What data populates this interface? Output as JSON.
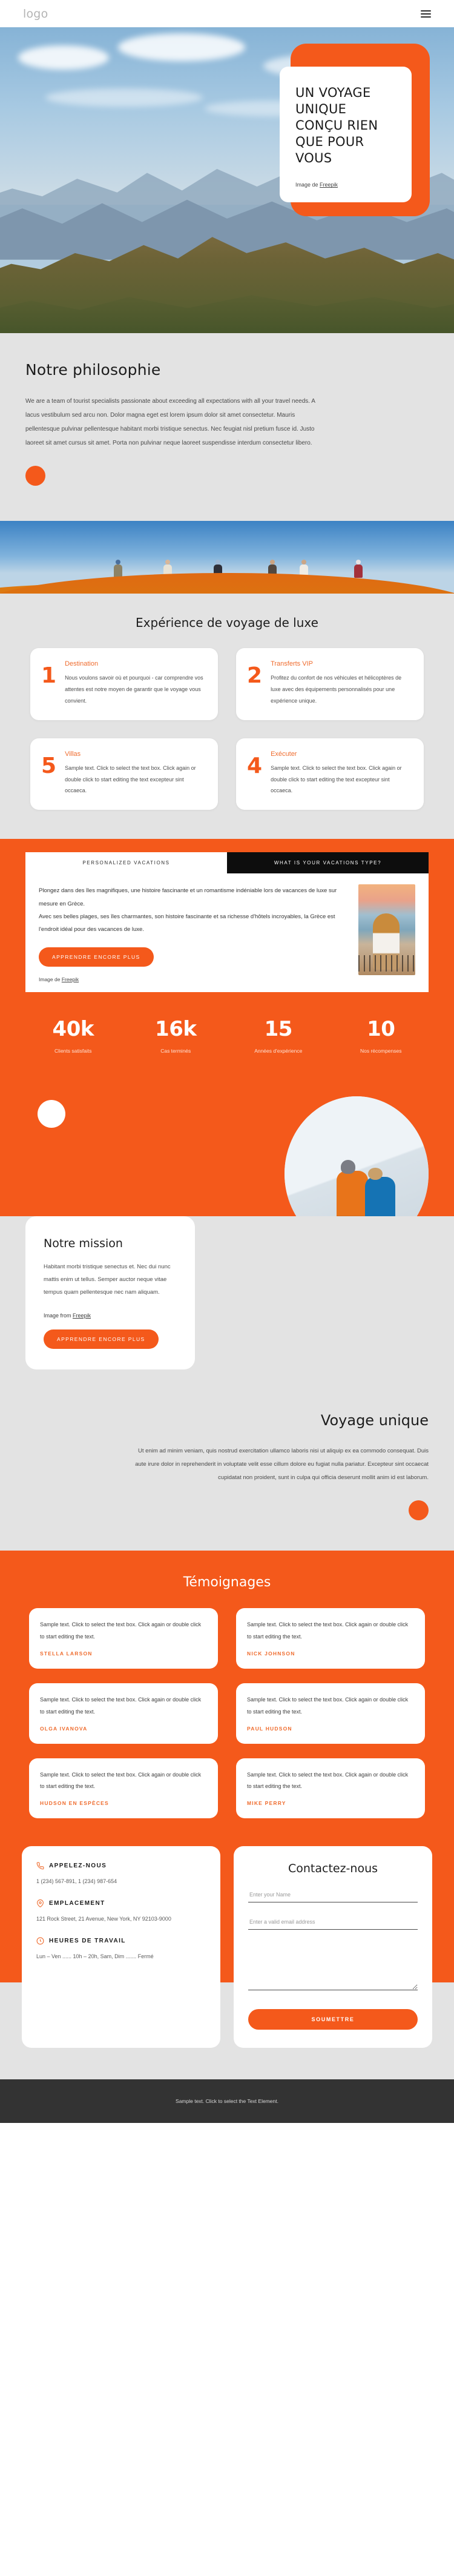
{
  "header": {
    "logo": "logo",
    "menu_icon": "hamburger-menu-icon"
  },
  "hero": {
    "title": "UN VOYAGE UNIQUE CONÇU RIEN QUE POUR VOUS",
    "credit_prefix": "Image de ",
    "credit_link": "Freepik",
    "accent_color": "#f4591b"
  },
  "philosophy": {
    "heading": "Notre philosophie",
    "body": "We are a team of tourist specialists passionate about exceeding all expectations with all your travel needs. A lacus vestibulum sed arcu non. Dolor magna eget est lorem ipsum dolor sit amet consectetur. Mauris pellentesque pulvinar pellentesque habitant morbi tristique senectus. Nec feugiat nisl pretium fusce id. Justo laoreet sit amet cursus sit amet. Porta non pulvinar neque laoreet suspendisse interdum consectetur libero."
  },
  "experience": {
    "heading": "Expérience de voyage de luxe",
    "cards": [
      {
        "number": "1",
        "title": "Destination",
        "text": "Nous voulons savoir où et pourquoi - car comprendre vos attentes est notre moyen de garantir que le voyage vous convient."
      },
      {
        "number": "2",
        "title": "Transferts VIP",
        "text": "Profitez du confort de nos véhicules et hélicoptères de luxe avec des équipements personnalisés pour une expérience unique."
      },
      {
        "number": "5",
        "title": "Villas",
        "text": "Sample text. Click to select the text box. Click again or double click to start editing the text excepteur sint occaeca."
      },
      {
        "number": "4",
        "title": "Exécuter",
        "text": "Sample text. Click to select the text box. Click again or double click to start editing the text excepteur sint occaeca."
      }
    ]
  },
  "vacations": {
    "tab_active": "PERSONALIZED VACATIONS",
    "tab_inactive": "WHAT IS YOUR VACATIONS TYPE?",
    "paragraph_1": "Plongez dans des îles magnifiques, une histoire fascinante et un romantisme indéniable lors de vacances de luxe sur mesure en Grèce.",
    "paragraph_2": "Avec ses belles plages, ses îles charmantes, son histoire fascinante et sa richesse d'hôtels incroyables, la Grèce est l'endroit idéal pour des vacances de luxe.",
    "cta": "APPRENDRE ENCORE PLUS",
    "credit_prefix": "Image de ",
    "credit_link": "Freepik"
  },
  "stats": [
    {
      "value": "40k",
      "label": "Clients satisfaits"
    },
    {
      "value": "16k",
      "label": "Cas terminés"
    },
    {
      "value": "15",
      "label": "Années d'expérience"
    },
    {
      "value": "10",
      "label": "Nos récompenses"
    }
  ],
  "mission": {
    "heading": "Notre mission",
    "body": "Habitant morbi tristique senectus et. Nec dui nunc mattis enim ut tellus. Semper auctor neque vitae tempus quam pellentesque nec nam aliquam.",
    "credit_prefix": "Image from ",
    "credit_link": "Freepik",
    "cta": "APPRENDRE ENCORE PLUS"
  },
  "unique": {
    "heading": "Voyage unique",
    "body": "Ut enim ad minim veniam, quis nostrud exercitation ullamco laboris nisi ut aliquip ex ea commodo consequat. Duis aute irure dolor in reprehenderit in voluptate velit esse cillum dolore eu fugiat nulla pariatur. Excepteur sint occaecat cupidatat non proident, sunt in culpa qui officia deserunt mollit anim id est laborum."
  },
  "testimonials": {
    "heading": "Témoignages",
    "items": [
      {
        "text": "Sample text. Click to select the text box. Click again or double click to start editing the text.",
        "author": "STELLA LARSON"
      },
      {
        "text": "Sample text. Click to select the text box. Click again or double click to start editing the text.",
        "author": "NICK JOHNSON"
      },
      {
        "text": "Sample text. Click to select the text box. Click again or double click to start editing the text.",
        "author": "OLGA IVANOVA"
      },
      {
        "text": "Sample text. Click to select the text box. Click again or double click to start editing the text.",
        "author": "PAUL HUDSON"
      },
      {
        "text": "Sample text. Click to select the text box. Click again or double click to start editing the text.",
        "author": "HUDSON EN ESPÈCES"
      },
      {
        "text": "Sample text. Click to select the text box. Click again or double click to start editing the text.",
        "author": "MIKE PERRY"
      }
    ]
  },
  "contact": {
    "call_label": "APPELEZ-NOUS",
    "call_value": "1 (234) 567-891, 1 (234) 987-654",
    "location_label": "EMPLACEMENT",
    "location_value": "121 Rock Street, 21 Avenue, New York, NY 92103-9000",
    "hours_label": "HEURES DE TRAVAIL",
    "hours_value": "Lun – Ven ...... 10h – 20h, Sam, Dim ....... Fermé",
    "form_title": "Contactez-nous",
    "name_placeholder": "Enter your Name",
    "email_placeholder": "Enter a valid email address",
    "message_placeholder": "",
    "submit": "SOUMETTRE"
  },
  "footer": {
    "text": "Sample text. Click to select the Text Element."
  }
}
